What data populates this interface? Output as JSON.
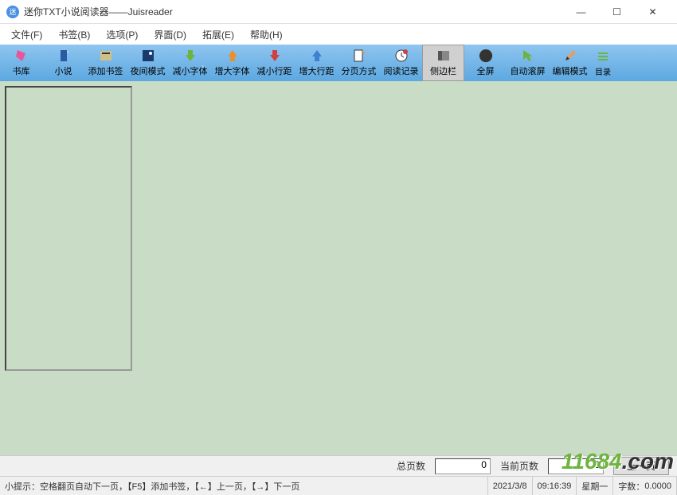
{
  "title": "迷你TXT小说阅读器——Juisreader",
  "menu": {
    "file": "文件(F)",
    "bookmark": "书签(B)",
    "options": "选项(P)",
    "interface": "界面(D)",
    "extension": "拓展(E)",
    "help": "帮助(H)"
  },
  "toolbar": {
    "library": "书库",
    "novel": "小说",
    "add_bookmark": "添加书签",
    "night_mode": "夜间模式",
    "dec_font": "减小字体",
    "inc_font": "增大字体",
    "dec_line": "减小行距",
    "inc_line": "增大行距",
    "page_mode": "分页方式",
    "read_history": "阅读记录",
    "sidebar": "侧边栏",
    "fullscreen": "全屏",
    "auto_scroll": "自动滚屏",
    "edit_mode": "编辑模式",
    "catalog": "目录"
  },
  "pager": {
    "total_pages_label": "总页数",
    "total_pages_value": "0",
    "current_page_label": "当前页数",
    "current_page_value": "0",
    "prev_btn": "上一页"
  },
  "status": {
    "tip": "小提示：空格翻页自动下一页，【F5】添加书签，【←】上一页，【→】下一页",
    "date": "2021/3/8",
    "time": "09:16:39",
    "weekday": "星期一",
    "word_count_label": "字数：",
    "word_count_value": "0.0000"
  },
  "watermark": {
    "text1": "11684",
    "text2": ".com"
  }
}
